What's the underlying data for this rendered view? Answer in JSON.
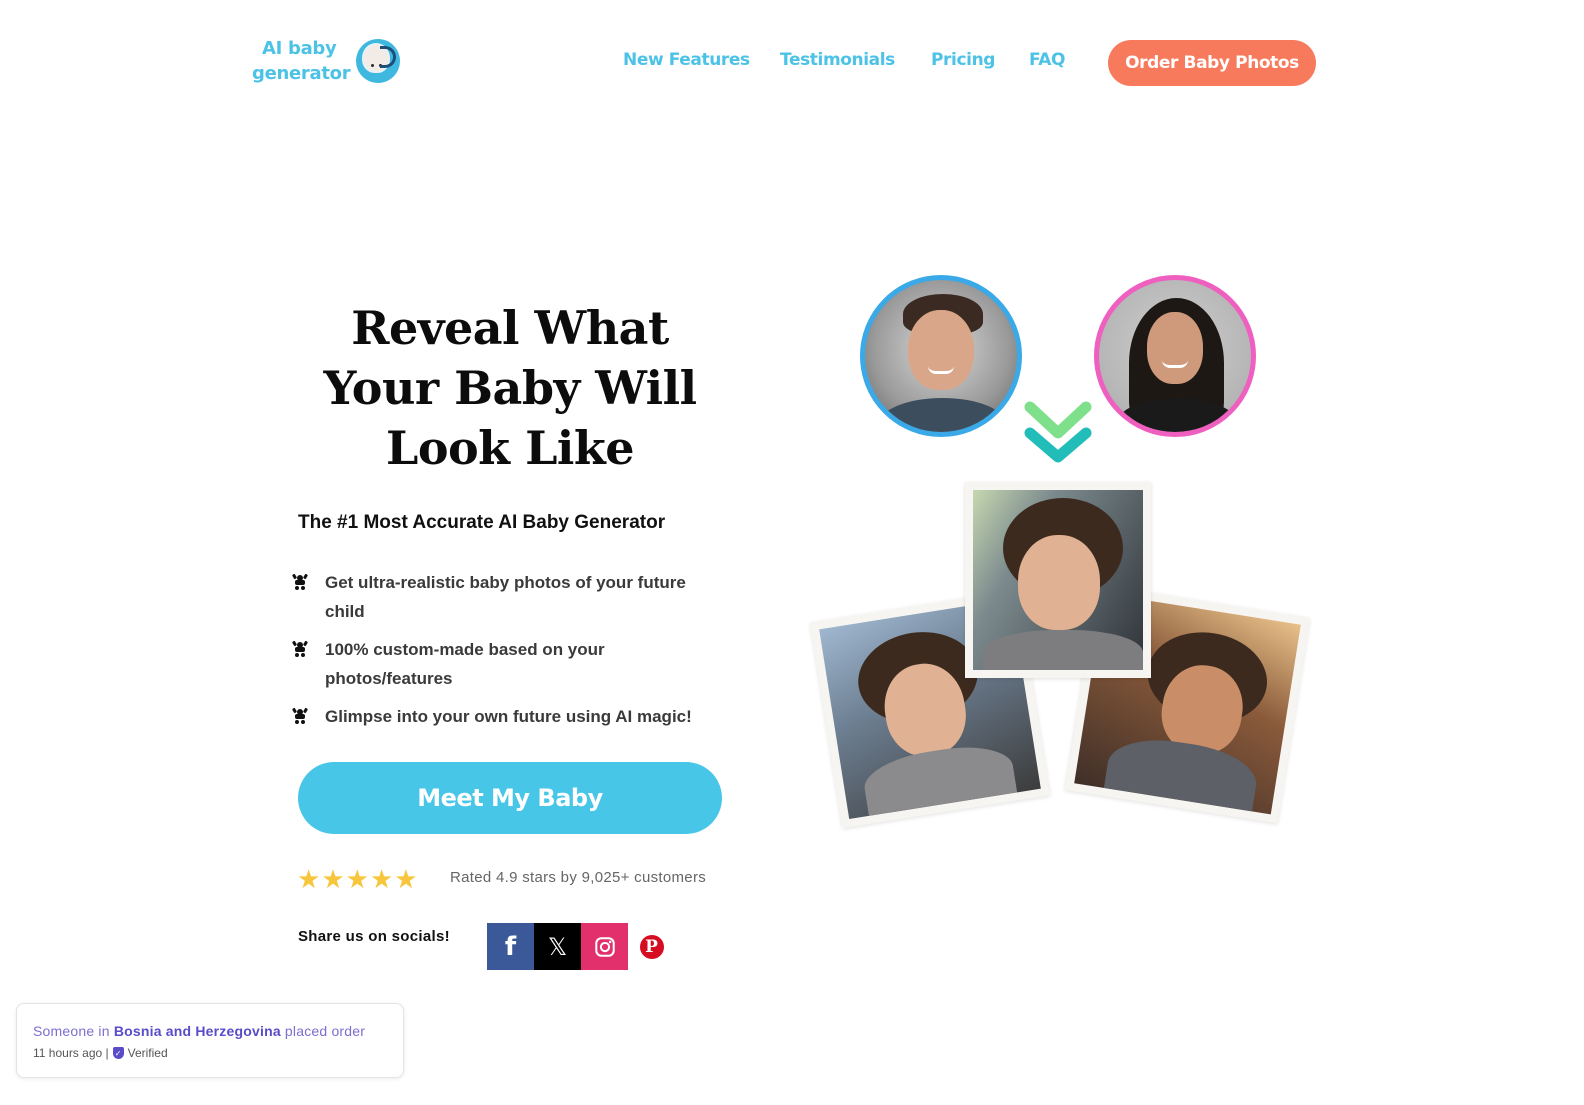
{
  "header": {
    "logo": {
      "line1": "AI baby",
      "line2": "generator"
    },
    "nav": [
      {
        "label": "New Features"
      },
      {
        "label": "Testimonials"
      },
      {
        "label": "Pricing"
      },
      {
        "label": "FAQ"
      }
    ],
    "order_button": "Order Baby Photos"
  },
  "hero": {
    "title": "Reveal What Your Baby Will Look Like",
    "subtitle": "The #1 Most Accurate AI Baby Generator",
    "features": [
      {
        "icon": "baby-icon",
        "text": "Get ultra-realistic baby photos of your future child"
      },
      {
        "icon": "baby-icon",
        "text": "100% custom-made based on your photos/features"
      },
      {
        "icon": "baby-icon",
        "text": "Glimpse into your own future using AI magic!"
      }
    ],
    "cta_label": "Meet My Baby",
    "rating": {
      "stars": 5,
      "value": 4.9,
      "text": "Rated 4.9 stars by 9,025+ customers"
    },
    "share": {
      "label": "Share us on socials!",
      "networks": [
        {
          "name": "facebook",
          "glyph": "f",
          "color": "#3b5998"
        },
        {
          "name": "x",
          "glyph": "𝕏",
          "color": "#000000"
        },
        {
          "name": "instagram",
          "color": "#e1306c"
        },
        {
          "name": "pinterest",
          "glyph": "P",
          "color": "#d50c22"
        }
      ]
    }
  },
  "visual": {
    "parents": [
      {
        "role": "father",
        "ring_color": "#3aa9e8"
      },
      {
        "role": "mother",
        "ring_color": "#ee5fbf"
      }
    ],
    "arrow_colors": [
      "#7ee08a",
      "#22bdb8"
    ],
    "child_photos": [
      "child-photo-1",
      "child-photo-2",
      "child-photo-3"
    ]
  },
  "toast": {
    "prefix": "Someone in",
    "location": "Bosnia and Herzegovina",
    "suffix": "placed order",
    "time": "11 hours ago |",
    "verified": "Verified"
  },
  "colors": {
    "brand_blue": "#4cc3e6",
    "cta_blue": "#48c6e8",
    "order_orange": "#f87a5c",
    "star": "#f8c63c",
    "toast_purple": "#5a4bc9"
  }
}
